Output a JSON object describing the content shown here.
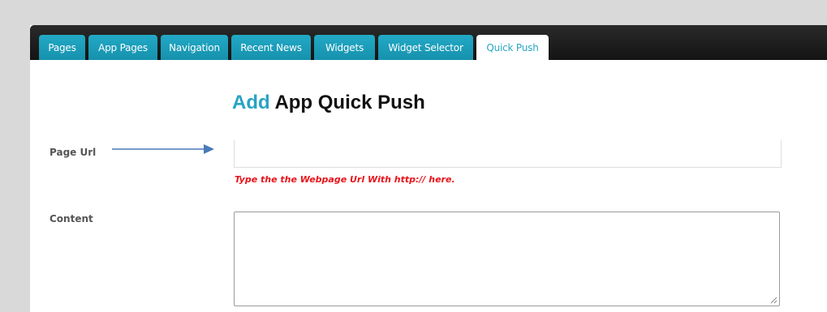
{
  "tabs": [
    {
      "label": "Pages"
    },
    {
      "label": "App Pages"
    },
    {
      "label": "Navigation"
    },
    {
      "label": "Recent News"
    },
    {
      "label": "Widgets"
    },
    {
      "label": "Widget Selector"
    },
    {
      "label": "Quick Push",
      "active": true
    }
  ],
  "form": {
    "heading_accent": "Add",
    "heading_rest": "App Quick Push",
    "page_url_label": "Page Url",
    "page_url_value": "",
    "page_url_hint": "Type the the Webpage Url With http:// here.",
    "content_label": "Content",
    "content_value": ""
  },
  "annotation": {
    "arrow_color": "#4a7ab7"
  },
  "colors": {
    "accent": "#27a3c3",
    "tab_bg": "#1b9ab7",
    "hint": "#e8141b"
  }
}
